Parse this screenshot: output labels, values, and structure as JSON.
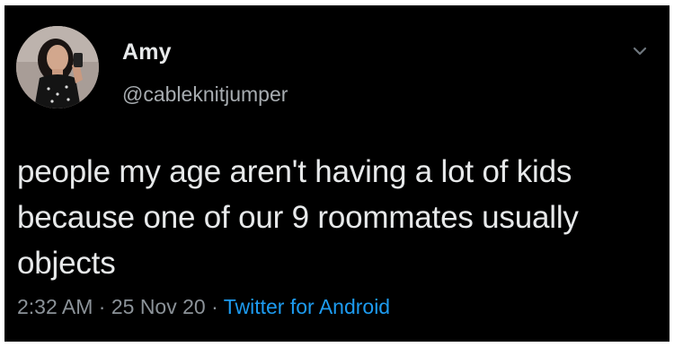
{
  "user": {
    "display_name": "Amy",
    "handle": "@cableknitjumper"
  },
  "tweet": {
    "text": "people my age aren't having a lot of kids because one of our 9 roommates usually objects",
    "time": "2:32 AM",
    "separator": " · ",
    "date": "25 Nov 20",
    "source": "Twitter for Android"
  },
  "icons": {
    "menu": "chevron-down-icon",
    "avatar": "profile-photo"
  },
  "colors": {
    "background": "#000000",
    "primary_text": "#e7e9ea",
    "secondary_text": "#8b9298",
    "link": "#1d9bf0"
  }
}
